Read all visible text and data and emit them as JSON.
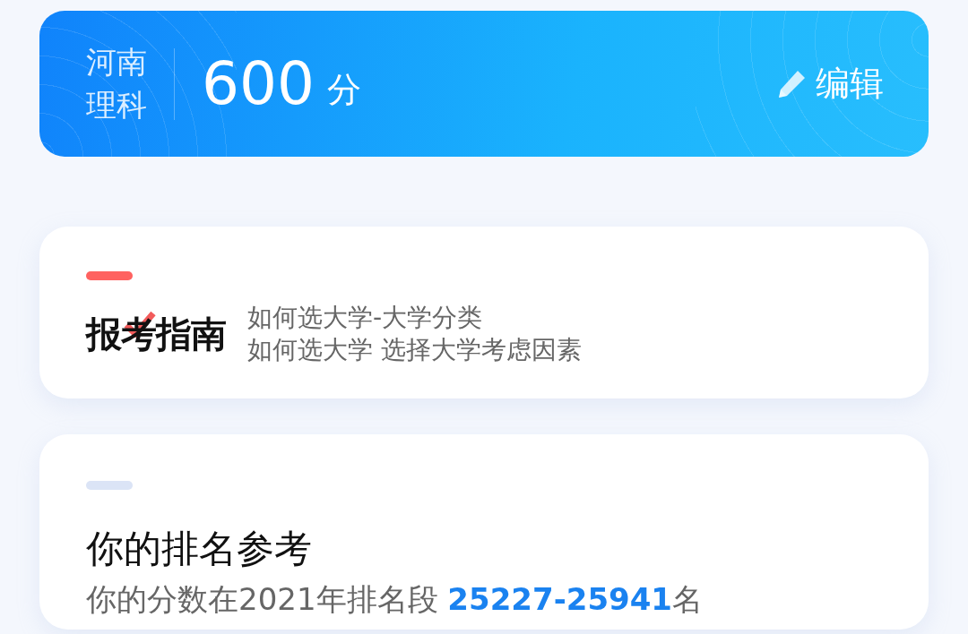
{
  "score_card": {
    "province": "河南",
    "subject": "理科",
    "score": "600",
    "unit": "分",
    "edit_label": "编辑"
  },
  "guide_card": {
    "title": "报考指南",
    "lines": [
      "如何选大学-大学分类",
      "如何选大学 选择大学考虑因素"
    ]
  },
  "rank_card": {
    "title": "你的排名参考",
    "sentence": "你的分数在2021年排名段 **25227-25941**名"
  }
}
